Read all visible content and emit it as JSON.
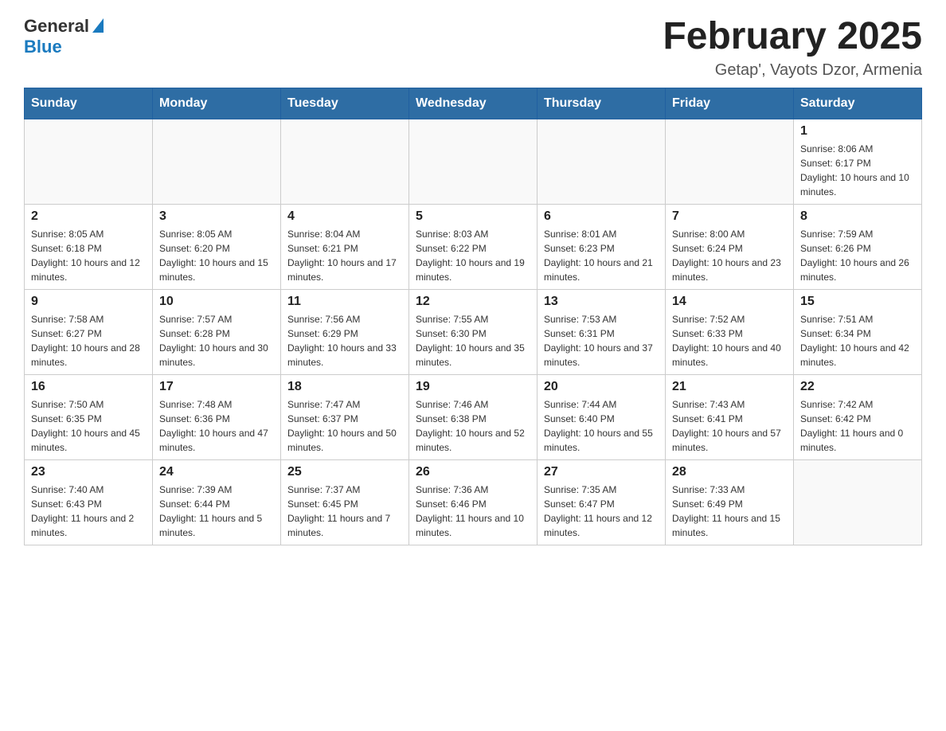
{
  "header": {
    "logo_general": "General",
    "logo_blue": "Blue",
    "month_title": "February 2025",
    "location": "Getap', Vayots Dzor, Armenia"
  },
  "days_of_week": [
    "Sunday",
    "Monday",
    "Tuesday",
    "Wednesday",
    "Thursday",
    "Friday",
    "Saturday"
  ],
  "weeks": [
    [
      {
        "day": "",
        "info": ""
      },
      {
        "day": "",
        "info": ""
      },
      {
        "day": "",
        "info": ""
      },
      {
        "day": "",
        "info": ""
      },
      {
        "day": "",
        "info": ""
      },
      {
        "day": "",
        "info": ""
      },
      {
        "day": "1",
        "info": "Sunrise: 8:06 AM\nSunset: 6:17 PM\nDaylight: 10 hours and 10 minutes."
      }
    ],
    [
      {
        "day": "2",
        "info": "Sunrise: 8:05 AM\nSunset: 6:18 PM\nDaylight: 10 hours and 12 minutes."
      },
      {
        "day": "3",
        "info": "Sunrise: 8:05 AM\nSunset: 6:20 PM\nDaylight: 10 hours and 15 minutes."
      },
      {
        "day": "4",
        "info": "Sunrise: 8:04 AM\nSunset: 6:21 PM\nDaylight: 10 hours and 17 minutes."
      },
      {
        "day": "5",
        "info": "Sunrise: 8:03 AM\nSunset: 6:22 PM\nDaylight: 10 hours and 19 minutes."
      },
      {
        "day": "6",
        "info": "Sunrise: 8:01 AM\nSunset: 6:23 PM\nDaylight: 10 hours and 21 minutes."
      },
      {
        "day": "7",
        "info": "Sunrise: 8:00 AM\nSunset: 6:24 PM\nDaylight: 10 hours and 23 minutes."
      },
      {
        "day": "8",
        "info": "Sunrise: 7:59 AM\nSunset: 6:26 PM\nDaylight: 10 hours and 26 minutes."
      }
    ],
    [
      {
        "day": "9",
        "info": "Sunrise: 7:58 AM\nSunset: 6:27 PM\nDaylight: 10 hours and 28 minutes."
      },
      {
        "day": "10",
        "info": "Sunrise: 7:57 AM\nSunset: 6:28 PM\nDaylight: 10 hours and 30 minutes."
      },
      {
        "day": "11",
        "info": "Sunrise: 7:56 AM\nSunset: 6:29 PM\nDaylight: 10 hours and 33 minutes."
      },
      {
        "day": "12",
        "info": "Sunrise: 7:55 AM\nSunset: 6:30 PM\nDaylight: 10 hours and 35 minutes."
      },
      {
        "day": "13",
        "info": "Sunrise: 7:53 AM\nSunset: 6:31 PM\nDaylight: 10 hours and 37 minutes."
      },
      {
        "day": "14",
        "info": "Sunrise: 7:52 AM\nSunset: 6:33 PM\nDaylight: 10 hours and 40 minutes."
      },
      {
        "day": "15",
        "info": "Sunrise: 7:51 AM\nSunset: 6:34 PM\nDaylight: 10 hours and 42 minutes."
      }
    ],
    [
      {
        "day": "16",
        "info": "Sunrise: 7:50 AM\nSunset: 6:35 PM\nDaylight: 10 hours and 45 minutes."
      },
      {
        "day": "17",
        "info": "Sunrise: 7:48 AM\nSunset: 6:36 PM\nDaylight: 10 hours and 47 minutes."
      },
      {
        "day": "18",
        "info": "Sunrise: 7:47 AM\nSunset: 6:37 PM\nDaylight: 10 hours and 50 minutes."
      },
      {
        "day": "19",
        "info": "Sunrise: 7:46 AM\nSunset: 6:38 PM\nDaylight: 10 hours and 52 minutes."
      },
      {
        "day": "20",
        "info": "Sunrise: 7:44 AM\nSunset: 6:40 PM\nDaylight: 10 hours and 55 minutes."
      },
      {
        "day": "21",
        "info": "Sunrise: 7:43 AM\nSunset: 6:41 PM\nDaylight: 10 hours and 57 minutes."
      },
      {
        "day": "22",
        "info": "Sunrise: 7:42 AM\nSunset: 6:42 PM\nDaylight: 11 hours and 0 minutes."
      }
    ],
    [
      {
        "day": "23",
        "info": "Sunrise: 7:40 AM\nSunset: 6:43 PM\nDaylight: 11 hours and 2 minutes."
      },
      {
        "day": "24",
        "info": "Sunrise: 7:39 AM\nSunset: 6:44 PM\nDaylight: 11 hours and 5 minutes."
      },
      {
        "day": "25",
        "info": "Sunrise: 7:37 AM\nSunset: 6:45 PM\nDaylight: 11 hours and 7 minutes."
      },
      {
        "day": "26",
        "info": "Sunrise: 7:36 AM\nSunset: 6:46 PM\nDaylight: 11 hours and 10 minutes."
      },
      {
        "day": "27",
        "info": "Sunrise: 7:35 AM\nSunset: 6:47 PM\nDaylight: 11 hours and 12 minutes."
      },
      {
        "day": "28",
        "info": "Sunrise: 7:33 AM\nSunset: 6:49 PM\nDaylight: 11 hours and 15 minutes."
      },
      {
        "day": "",
        "info": ""
      }
    ]
  ]
}
